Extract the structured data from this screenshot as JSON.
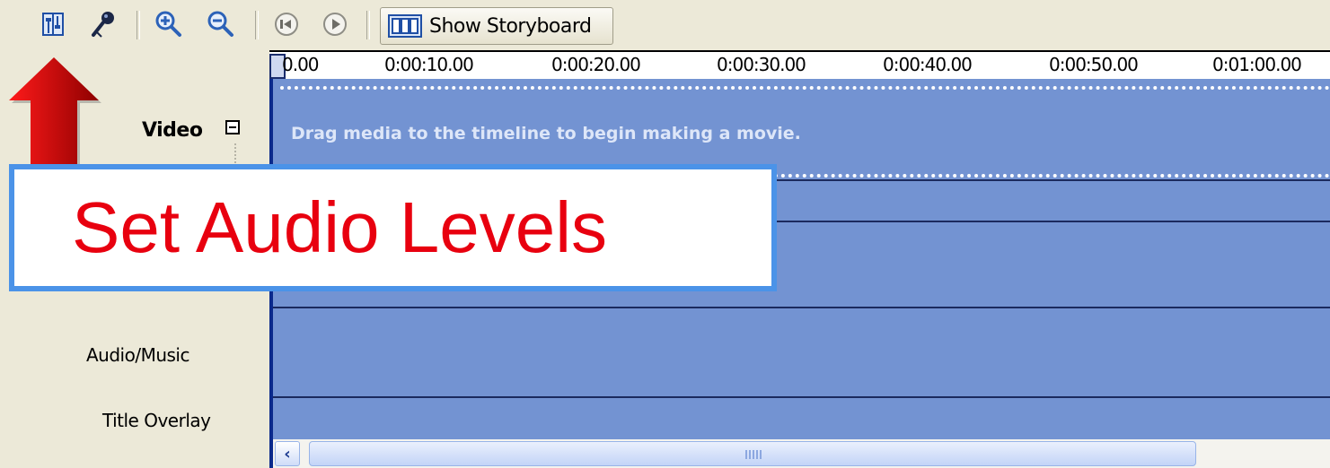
{
  "toolbar": {
    "tool_icons": [
      "set-audio-levels-icon",
      "narrate-timeline-icon",
      "zoom-in-icon",
      "zoom-out-icon",
      "rewind-icon",
      "play-icon"
    ],
    "storyboard_button_label": "Show Storyboard"
  },
  "tracks": {
    "video_label": "Video",
    "audio_music_label": "Audio/Music",
    "title_overlay_label": "Title Overlay",
    "drag_hint": "Drag media to the timeline to begin making a movie."
  },
  "ruler": {
    "ticks": [
      "0.00",
      "0:00:10.00",
      "0:00:20.00",
      "0:00:30.00",
      "0:00:40.00",
      "0:00:50.00",
      "0:01:00.00"
    ]
  },
  "callout": {
    "text": "Set Audio Levels"
  },
  "colors": {
    "timeline_bg": "#7393d2",
    "callout_text": "#e8000f",
    "callout_border": "#4b93e8",
    "arrow": "#c80000"
  }
}
